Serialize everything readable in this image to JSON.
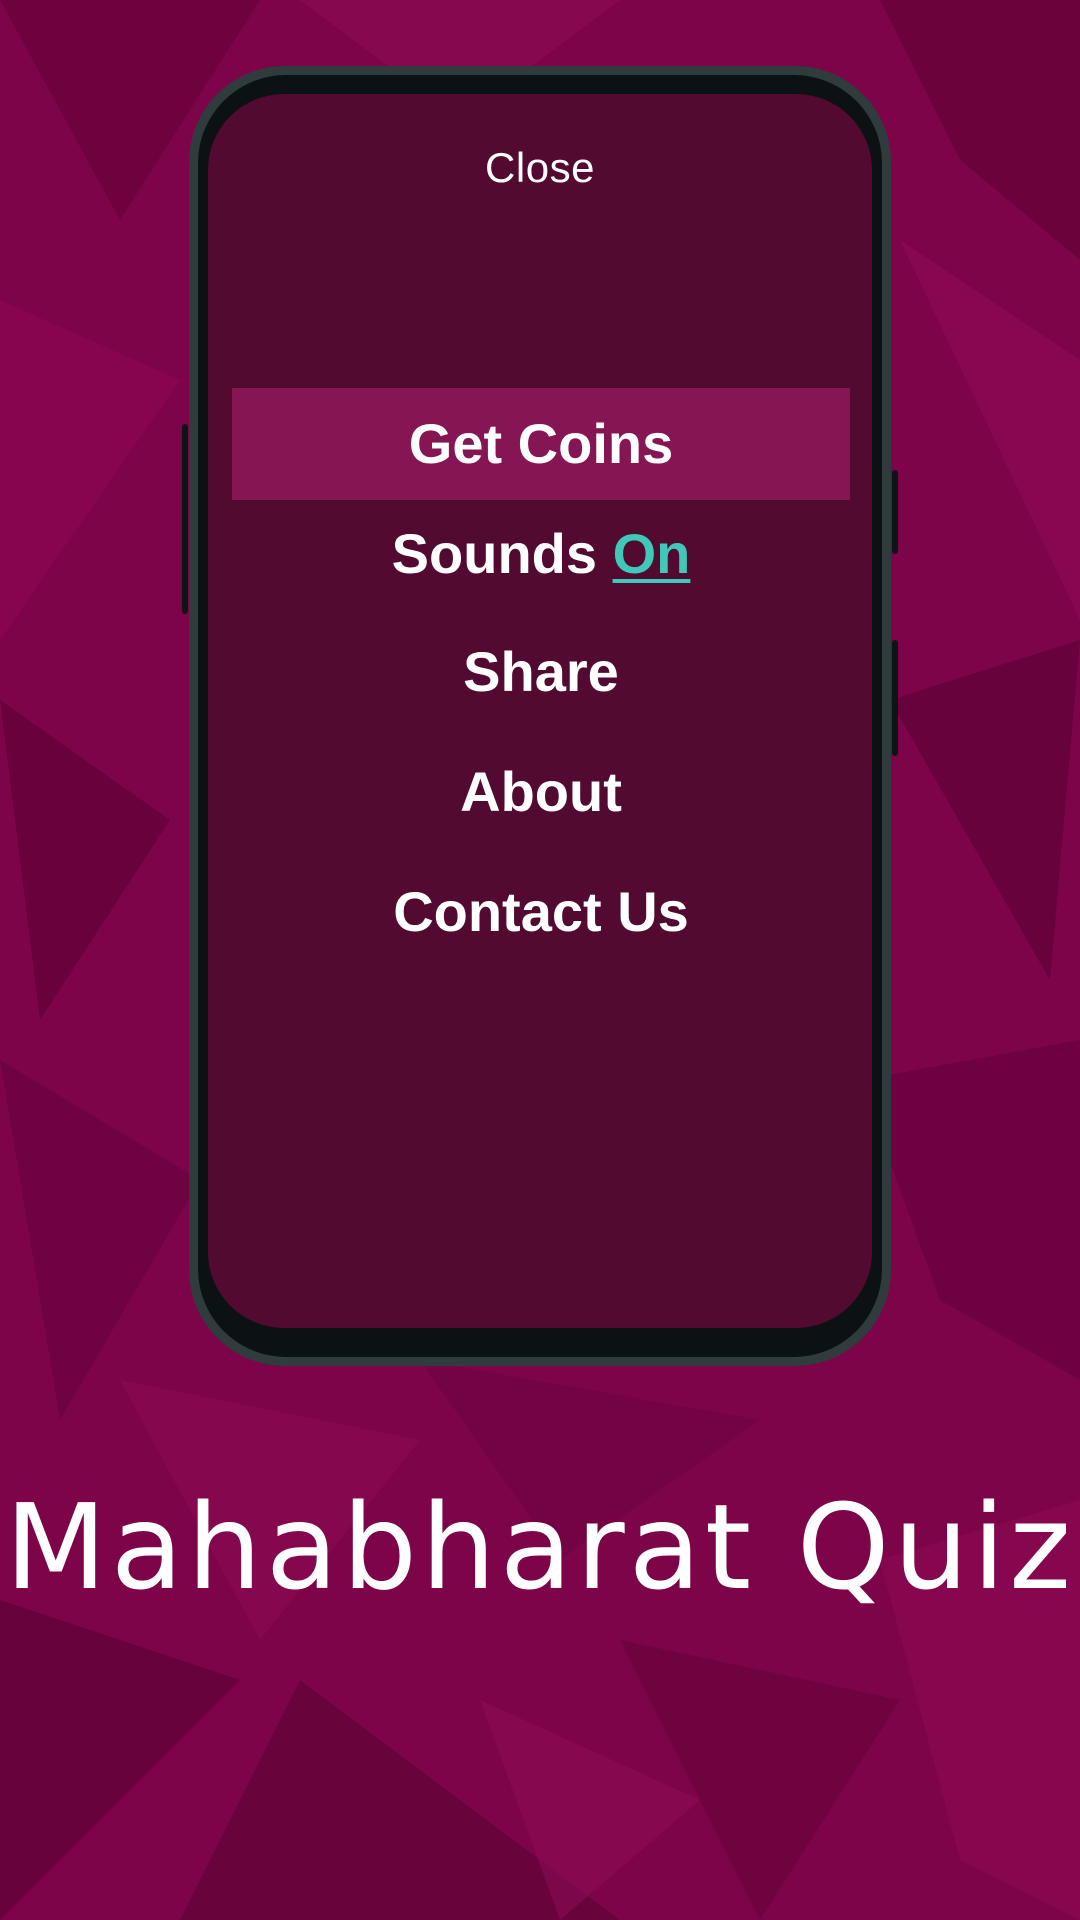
{
  "colors": {
    "background": "#7a0347",
    "screen": "#520a31",
    "active_item": "#851553",
    "accent": "#3fc9b8",
    "phone_frame": "#2f3b3d"
  },
  "menu": {
    "close_label": "Close",
    "items": [
      {
        "label": "Get Coins",
        "active": true
      },
      {
        "label": "Sounds",
        "state": "On"
      },
      {
        "label": "Share"
      },
      {
        "label": "About"
      },
      {
        "label": "Contact Us"
      }
    ]
  },
  "app": {
    "title": "Mahabharat Quiz"
  }
}
